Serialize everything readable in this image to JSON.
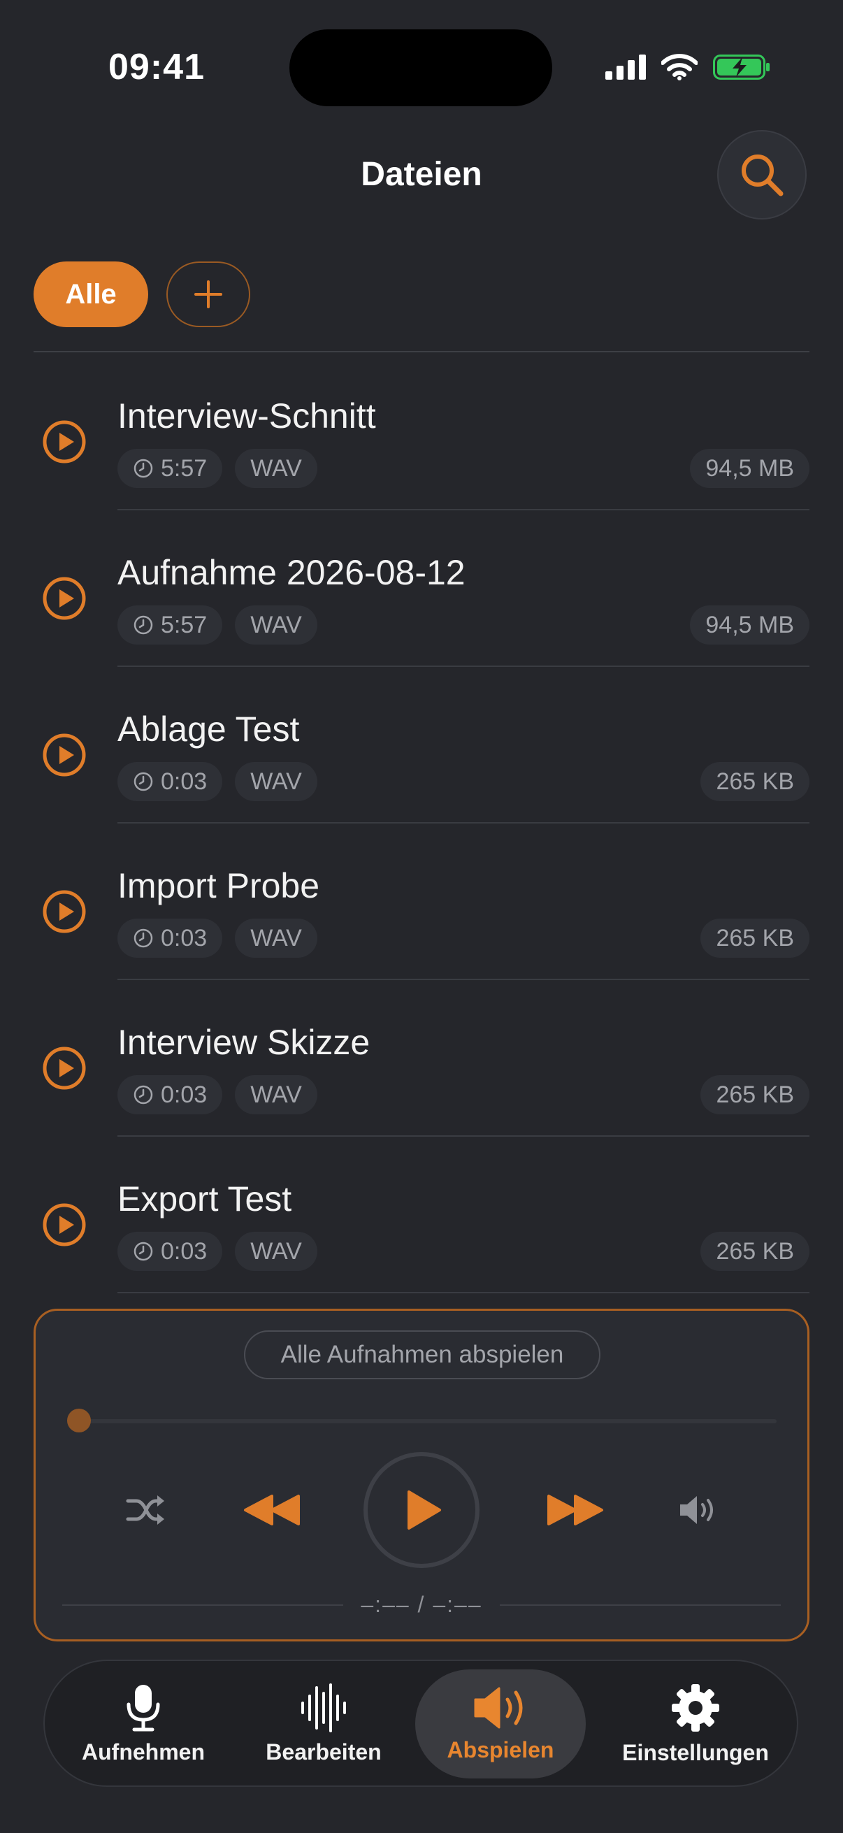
{
  "status_bar": {
    "time": "09:41"
  },
  "header": {
    "title": "Dateien"
  },
  "filters": {
    "all_label": "Alle"
  },
  "files": [
    {
      "name": "Interview-Schnitt",
      "duration": "5:57",
      "format": "WAV",
      "size": "94,5 MB"
    },
    {
      "name": "Aufnahme 2026-08-12",
      "duration": "5:57",
      "format": "WAV",
      "size": "94,5 MB"
    },
    {
      "name": "Ablage Test",
      "duration": "0:03",
      "format": "WAV",
      "size": "265 KB"
    },
    {
      "name": "Import Probe",
      "duration": "0:03",
      "format": "WAV",
      "size": "265 KB"
    },
    {
      "name": "Interview Skizze",
      "duration": "0:03",
      "format": "WAV",
      "size": "265 KB"
    },
    {
      "name": "Export Test",
      "duration": "0:03",
      "format": "WAV",
      "size": "265 KB"
    }
  ],
  "player": {
    "play_all_label": "Alle Aufnahmen abspielen",
    "progress": 0,
    "time_display": "–:–– / –:––"
  },
  "tabs": [
    {
      "label": "Aufnehmen",
      "icon": "microphone-icon"
    },
    {
      "label": "Bearbeiten",
      "icon": "waveform-icon"
    },
    {
      "label": "Abspielen",
      "icon": "speaker-icon",
      "active": true
    },
    {
      "label": "Einstellungen",
      "icon": "gear-icon"
    }
  ],
  "colors": {
    "accent": "#e07d2a",
    "background": "#25262b",
    "battery": "#34c759"
  }
}
